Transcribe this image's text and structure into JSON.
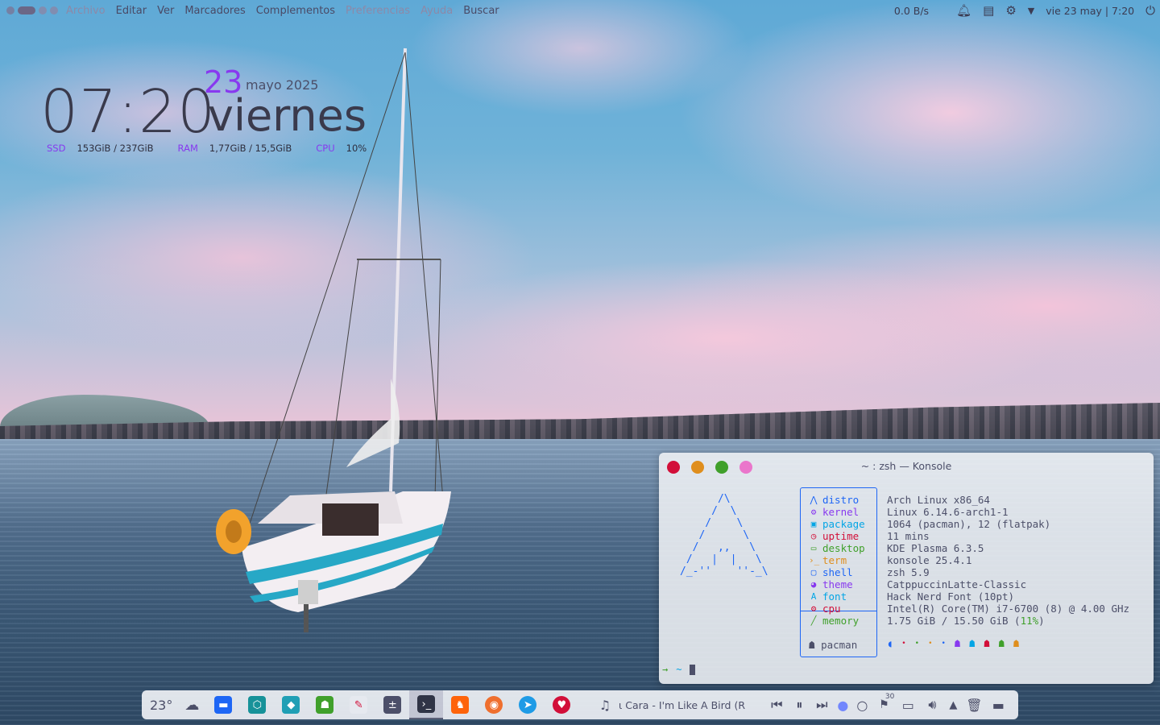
{
  "menubar": {
    "items": [
      "Archivo",
      "Editar",
      "Ver",
      "Marcadores",
      "Complementos",
      "Preferencias",
      "Ayuda",
      "Buscar"
    ]
  },
  "tray": {
    "net_speed": "0.0 B/s",
    "datetime": "vie 23 may | 7:20",
    "icons": [
      "notification-bell-icon",
      "clipboard-icon",
      "settings-gear-icon",
      "expand-arrow-icon",
      "power-icon"
    ]
  },
  "clock_widget": {
    "time": "07:20",
    "day_number": "23",
    "month_year": "mayo 2025",
    "weekday": "viernes",
    "stats": [
      {
        "label": "SSD",
        "value": "153GiB / 237GiB"
      },
      {
        "label": "RAM",
        "value": "1,77GiB / 15,5GiB"
      },
      {
        "label": "CPU",
        "value": "10%"
      }
    ]
  },
  "konsole": {
    "title": "~ : zsh — Konsole",
    "buttons": {
      "close": "#d20f39",
      "minimize": "#df8e1d",
      "maximize": "#40a02b",
      "extra": "#ea76cb"
    },
    "ascii_art": "      /\\\n     /  \\\n    /    \\\n   /      \\\n  /   ,,   \\\n /   |  |   \\\n/_-''    ''-_\\",
    "info": [
      {
        "icon": "arch-icon",
        "glyph": "⋀",
        "key": "distro",
        "color": "#1e66f5",
        "value": "Arch Linux x86_64"
      },
      {
        "icon": "kernel-gear-icon",
        "glyph": "⚙",
        "key": "kernel",
        "color": "#8839ef",
        "value": "Linux 6.14.6-arch1-1"
      },
      {
        "icon": "package-icon",
        "glyph": "▣",
        "key": "package",
        "color": "#04a5e5",
        "value": "1064 (pacman), 12 (flatpak)"
      },
      {
        "icon": "clock-icon",
        "glyph": "◷",
        "key": "uptime",
        "color": "#d20f39",
        "value": "11 mins"
      },
      {
        "icon": "monitor-icon",
        "glyph": "▭",
        "key": "desktop",
        "color": "#40a02b",
        "value": "KDE Plasma 6.3.5"
      },
      {
        "icon": "terminal-icon",
        "glyph": "›_",
        "key": "term",
        "color": "#df8e1d",
        "value": "konsole 25.4.1"
      },
      {
        "icon": "shell-icon",
        "glyph": "▢",
        "key": "shell",
        "color": "#1e66f5",
        "value": "zsh 5.9"
      },
      {
        "icon": "palette-icon",
        "glyph": "◕",
        "key": "theme",
        "color": "#8839ef",
        "value": "CatppuccinLatte-Classic"
      },
      {
        "icon": "font-icon",
        "glyph": "A",
        "key": "font",
        "color": "#04a5e5",
        "value": "Hack Nerd Font (10pt)"
      },
      {
        "icon": "cpu-chip-icon",
        "glyph": "⚙",
        "key": "cpu",
        "color": "#d20f39",
        "value": "Intel(R) Core(TM) i7-6700 (8) @ 4.00 GHz"
      },
      {
        "icon": "memory-icon",
        "glyph": "╱",
        "key": "memory",
        "color": "#40a02b",
        "value_prefix": "1.75 GiB / 15.50 GiB (",
        "value_pct": "11%",
        "value_suffix": ")"
      }
    ],
    "pacman_label": "pacman",
    "palette": [
      "#1e66f5",
      "#d20f39",
      "#40a02b",
      "#df8e1d",
      "#1e66f5",
      "#8839ef",
      "#04a5e5",
      "#d20f39",
      "#40a02b",
      "#df8e1d"
    ],
    "prompt_arrow": "→",
    "prompt_dir": "~"
  },
  "dock": {
    "temperature": "23°",
    "media_title": "ι Cara - I'm Like A Bird (R",
    "systray_badge": "30"
  }
}
